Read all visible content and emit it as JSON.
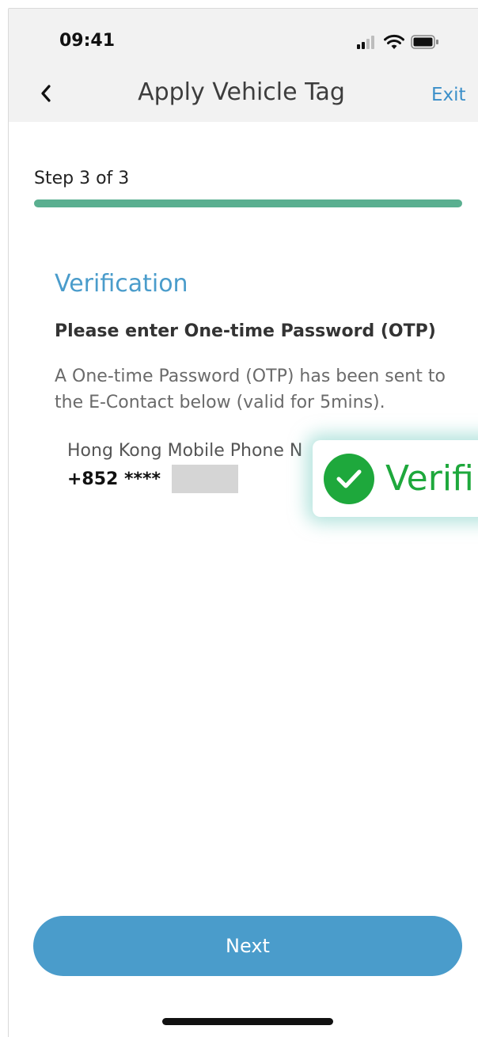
{
  "status_bar": {
    "time": "09:41",
    "icons": [
      "signal-icon",
      "wifi-icon",
      "battery-icon"
    ]
  },
  "nav": {
    "title": "Apply Vehicle Tag",
    "exit_label": "Exit",
    "back_icon": "chevron-left-icon"
  },
  "step": {
    "label": "Step 3 of 3",
    "progress": 1.0
  },
  "verification": {
    "title": "Verification",
    "heading": "Please enter One-time Password (OTP)",
    "description": "A One-time Password (OTP) has been sent to the E-Contact below (valid for 5mins).",
    "contact_label": "Hong Kong Mobile Phone N",
    "contact_value": "+852 ****"
  },
  "toast": {
    "icon": "check-circle-icon",
    "text": "Verifi"
  },
  "footer": {
    "next_label": "Next"
  },
  "colors": {
    "accent": "#4a9ccb",
    "progress": "#5aaf90",
    "success": "#1ea83c"
  }
}
